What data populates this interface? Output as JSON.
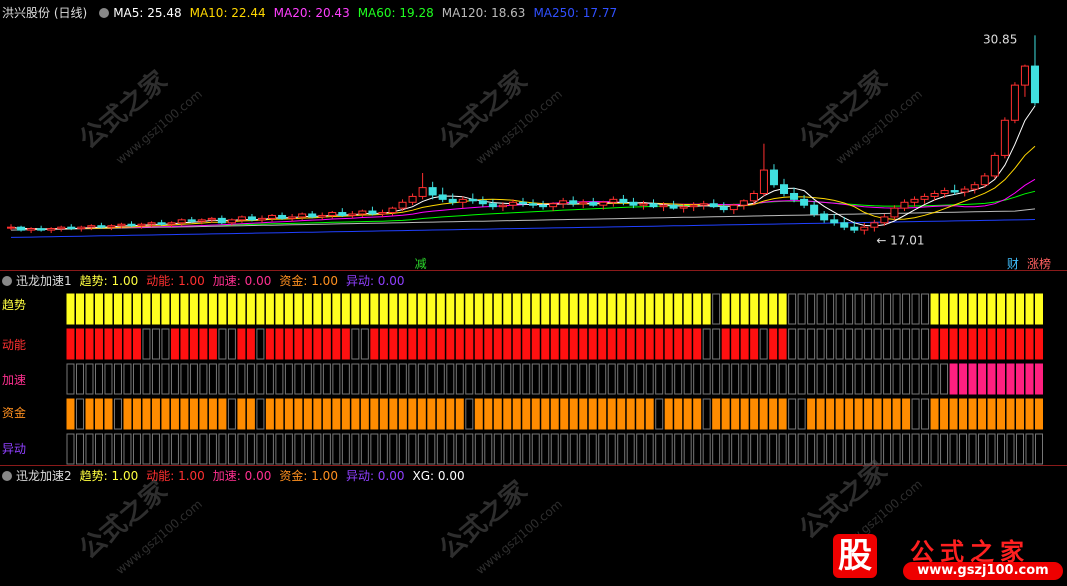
{
  "main_header": {
    "stock": "洪兴股份 (日线)",
    "ma5": "MA5: 25.48",
    "ma10": "MA10: 22.44",
    "ma20": "MA20: 20.43",
    "ma60": "MA60: 19.28",
    "ma120": "MA120: 18.63",
    "ma250": "MA250: 17.77"
  },
  "price_labels": {
    "high": "30.85",
    "low": "17.01"
  },
  "event_markers": {
    "jian": "减",
    "cai": "财",
    "zhangbang": "涨榜"
  },
  "ind1_header": {
    "name": "迅龙加速1",
    "trend": "趋势: 1.00",
    "energy": "动能: 1.00",
    "accel": "加速: 0.00",
    "fund": "资金: 1.00",
    "anomaly": "异动: 0.00"
  },
  "ind1_rows": {
    "trend": "趋势",
    "energy": "动能",
    "accel": "加速",
    "fund": "资金",
    "anomaly": "异动"
  },
  "ind2_header": {
    "name": "迅龙加速2",
    "trend": "趋势: 1.00",
    "energy": "动能: 1.00",
    "accel": "加速: 0.00",
    "fund": "资金: 1.00",
    "anomaly": "异动: 0.00",
    "xg": "XG: 0.00"
  },
  "watermark": {
    "text": "公式之家",
    "url": "www.gszj100.com"
  },
  "logo": {
    "badge": "股",
    "text": "公式之家",
    "url": "www.gszj100.com"
  },
  "colors": {
    "ma5": "#ffffff",
    "ma10": "#ffd700",
    "ma20": "#ff00ff",
    "ma60": "#00ff00",
    "ma120": "#bbbbbb",
    "ma250": "#2040ff",
    "up": "#ff3030",
    "down": "#40e0e0",
    "trend": "#ffff20",
    "energy": "#ff1010",
    "accel": "#ff2080",
    "fund": "#ff8c00",
    "anomaly": "#8020ff"
  },
  "chart_data": {
    "type": "candlestick",
    "ylim": [
      16,
      31.5
    ],
    "candles_ohlc": [
      [
        17.9,
        18.1,
        17.7,
        17.9
      ],
      [
        17.9,
        18.0,
        17.6,
        17.7
      ],
      [
        17.7,
        17.9,
        17.5,
        17.8
      ],
      [
        17.8,
        18.0,
        17.6,
        17.7
      ],
      [
        17.7,
        17.9,
        17.5,
        17.8
      ],
      [
        17.8,
        18.0,
        17.6,
        17.9
      ],
      [
        17.9,
        18.1,
        17.7,
        17.8
      ],
      [
        17.8,
        18.0,
        17.6,
        17.9
      ],
      [
        17.9,
        18.1,
        17.7,
        18.0
      ],
      [
        18.0,
        18.2,
        17.8,
        17.9
      ],
      [
        17.9,
        18.1,
        17.7,
        18.0
      ],
      [
        18.0,
        18.2,
        17.8,
        18.1
      ],
      [
        18.1,
        18.3,
        17.9,
        18.0
      ],
      [
        18.0,
        18.2,
        17.8,
        18.1
      ],
      [
        18.1,
        18.3,
        17.9,
        18.2
      ],
      [
        18.2,
        18.4,
        18.0,
        18.1
      ],
      [
        18.1,
        18.3,
        17.9,
        18.2
      ],
      [
        18.2,
        18.5,
        18.0,
        18.4
      ],
      [
        18.4,
        18.6,
        18.2,
        18.3
      ],
      [
        18.3,
        18.5,
        18.1,
        18.4
      ],
      [
        18.4,
        18.6,
        18.2,
        18.5
      ],
      [
        18.5,
        18.7,
        18.1,
        18.2
      ],
      [
        18.2,
        18.5,
        18.0,
        18.4
      ],
      [
        18.4,
        18.7,
        18.2,
        18.6
      ],
      [
        18.6,
        18.8,
        18.3,
        18.4
      ],
      [
        18.4,
        18.7,
        18.2,
        18.5
      ],
      [
        18.5,
        18.8,
        18.3,
        18.7
      ],
      [
        18.7,
        18.9,
        18.4,
        18.5
      ],
      [
        18.5,
        18.8,
        18.3,
        18.6
      ],
      [
        18.6,
        18.9,
        18.4,
        18.8
      ],
      [
        18.8,
        19.0,
        18.5,
        18.6
      ],
      [
        18.6,
        18.9,
        18.4,
        18.7
      ],
      [
        18.7,
        19.0,
        18.5,
        18.9
      ],
      [
        18.9,
        19.2,
        18.6,
        18.7
      ],
      [
        18.7,
        19.0,
        18.5,
        18.8
      ],
      [
        18.8,
        19.1,
        18.6,
        19.0
      ],
      [
        19.0,
        19.3,
        18.7,
        18.8
      ],
      [
        18.8,
        19.1,
        18.6,
        18.9
      ],
      [
        18.9,
        19.3,
        18.7,
        19.2
      ],
      [
        19.2,
        19.8,
        19.0,
        19.6
      ],
      [
        19.6,
        20.2,
        19.4,
        20.0
      ],
      [
        20.0,
        21.6,
        19.8,
        20.6
      ],
      [
        20.6,
        21.0,
        19.8,
        20.1
      ],
      [
        20.1,
        20.6,
        19.6,
        19.8
      ],
      [
        19.8,
        20.2,
        19.4,
        19.6
      ],
      [
        19.6,
        20.0,
        19.2,
        19.8
      ],
      [
        19.8,
        20.2,
        19.5,
        19.7
      ],
      [
        19.7,
        20.0,
        19.3,
        19.5
      ],
      [
        19.5,
        19.8,
        19.1,
        19.3
      ],
      [
        19.3,
        19.6,
        19.0,
        19.4
      ],
      [
        19.4,
        19.8,
        19.1,
        19.6
      ],
      [
        19.6,
        19.9,
        19.3,
        19.5
      ],
      [
        19.5,
        19.8,
        19.2,
        19.4
      ],
      [
        19.4,
        19.7,
        19.1,
        19.3
      ],
      [
        19.3,
        19.6,
        19.0,
        19.5
      ],
      [
        19.5,
        19.9,
        19.2,
        19.7
      ],
      [
        19.7,
        20.0,
        19.3,
        19.5
      ],
      [
        19.5,
        19.8,
        19.2,
        19.6
      ],
      [
        19.6,
        19.9,
        19.3,
        19.4
      ],
      [
        19.4,
        19.7,
        19.1,
        19.6
      ],
      [
        19.6,
        20.0,
        19.3,
        19.8
      ],
      [
        19.8,
        20.1,
        19.4,
        19.6
      ],
      [
        19.6,
        19.9,
        19.2,
        19.4
      ],
      [
        19.4,
        19.7,
        19.1,
        19.5
      ],
      [
        19.5,
        19.8,
        19.2,
        19.3
      ],
      [
        19.3,
        19.6,
        19.0,
        19.4
      ],
      [
        19.4,
        19.7,
        19.1,
        19.2
      ],
      [
        19.2,
        19.5,
        18.9,
        19.3
      ],
      [
        19.3,
        19.6,
        19.0,
        19.4
      ],
      [
        19.4,
        19.7,
        19.1,
        19.5
      ],
      [
        19.5,
        19.8,
        19.2,
        19.3
      ],
      [
        19.3,
        19.6,
        18.9,
        19.1
      ],
      [
        19.1,
        19.5,
        18.8,
        19.4
      ],
      [
        19.4,
        19.8,
        19.1,
        19.7
      ],
      [
        19.7,
        20.4,
        19.4,
        20.2
      ],
      [
        20.2,
        23.6,
        20.0,
        21.8
      ],
      [
        21.8,
        22.2,
        20.6,
        20.8
      ],
      [
        20.8,
        21.2,
        20.0,
        20.2
      ],
      [
        20.2,
        20.6,
        19.6,
        19.8
      ],
      [
        19.8,
        20.1,
        19.2,
        19.4
      ],
      [
        19.4,
        19.7,
        18.6,
        18.8
      ],
      [
        18.8,
        19.0,
        18.2,
        18.4
      ],
      [
        18.4,
        18.8,
        18.0,
        18.2
      ],
      [
        18.2,
        18.6,
        17.7,
        17.9
      ],
      [
        17.9,
        18.3,
        17.5,
        17.7
      ],
      [
        17.7,
        18.2,
        17.4,
        17.9
      ],
      [
        17.9,
        18.4,
        17.6,
        18.2
      ],
      [
        18.2,
        18.8,
        18.0,
        18.6
      ],
      [
        18.6,
        19.4,
        18.4,
        19.2
      ],
      [
        19.2,
        19.8,
        19.0,
        19.6
      ],
      [
        19.6,
        20.0,
        19.3,
        19.8
      ],
      [
        19.8,
        20.2,
        19.5,
        20.0
      ],
      [
        20.0,
        20.4,
        19.7,
        20.2
      ],
      [
        20.2,
        20.6,
        19.9,
        20.4
      ],
      [
        20.4,
        20.8,
        20.1,
        20.3
      ],
      [
        20.3,
        20.7,
        20.0,
        20.5
      ],
      [
        20.5,
        21.0,
        20.2,
        20.8
      ],
      [
        20.8,
        21.6,
        20.6,
        21.4
      ],
      [
        21.4,
        23.0,
        21.2,
        22.8
      ],
      [
        22.8,
        25.4,
        22.6,
        25.2
      ],
      [
        25.2,
        27.8,
        25.0,
        27.6
      ],
      [
        27.6,
        29.0,
        26.8,
        28.9
      ],
      [
        28.9,
        31.0,
        26.2,
        26.4
      ]
    ],
    "ind1_rows": {
      "trend": "111111111111111111111111111111111111111111111111111111111111111111110111111100000000000000011111111111111111111111",
      "energy": "111111110001111100110111111111001111111111111111111111111111111111100111101100000000000000011111111111111111111111",
      "accel": "000000000000000000000000000000000000000000000000000000000000000000000000000000000000000000000111111111111111111111",
      "fund": "101110111111111110110111111111111111111111011111111111111111110111101111111100111111111110011111111111111111111111",
      "anomaly": "000000000000000000000000000000000000000000000000000000000000000000000000000000000000000000000000000000000000000000"
    }
  }
}
